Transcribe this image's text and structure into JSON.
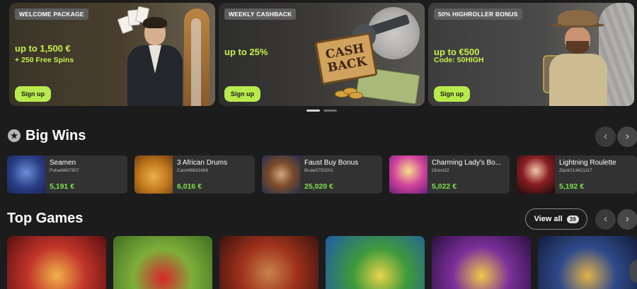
{
  "promos": [
    {
      "tag": "WELCOME PACKAGE",
      "headline": "up to 1,500 €",
      "sub": "+ 250 Free Spins",
      "button": "Sign up"
    },
    {
      "tag": "WEEKLY CASHBACK",
      "headline": "up to 25%",
      "sub": "",
      "button": "Sign up",
      "sign_line1": "CASH",
      "sign_line2": "BACK"
    },
    {
      "tag": "50% HIGHROLLER BONUS",
      "headline": "up to €500",
      "sub": "Code: 50HIGH",
      "button": "Sign up"
    }
  ],
  "big_wins": {
    "title": "Big Wins",
    "items": [
      {
        "game": "Seamen",
        "user": "Pulse6667907",
        "amount": "5,191 €"
      },
      {
        "game": "3 African Drums",
        "user": "Cash48631666",
        "amount": "6,016 €"
      },
      {
        "game": "Faust Buy Bonus",
        "user": "Brute5750201",
        "amount": "25,020 €"
      },
      {
        "game": "Charming Lady's Bo...",
        "user": "Ghost22",
        "amount": "5,022 €"
      },
      {
        "game": "Lightning Roulette",
        "user": "Ztpdr213421117",
        "amount": "5,192 €"
      }
    ]
  },
  "top_games": {
    "title": "Top Games",
    "view_all_label": "View all",
    "view_all_count": "39"
  },
  "arrows": {
    "prev": "‹",
    "next": "›"
  },
  "star_glyph": "★",
  "colors": {
    "accent_green": "#b8ea4d",
    "amount_green": "#7ce04a",
    "background": "#1c1c1c",
    "card_bg": "#323232"
  }
}
